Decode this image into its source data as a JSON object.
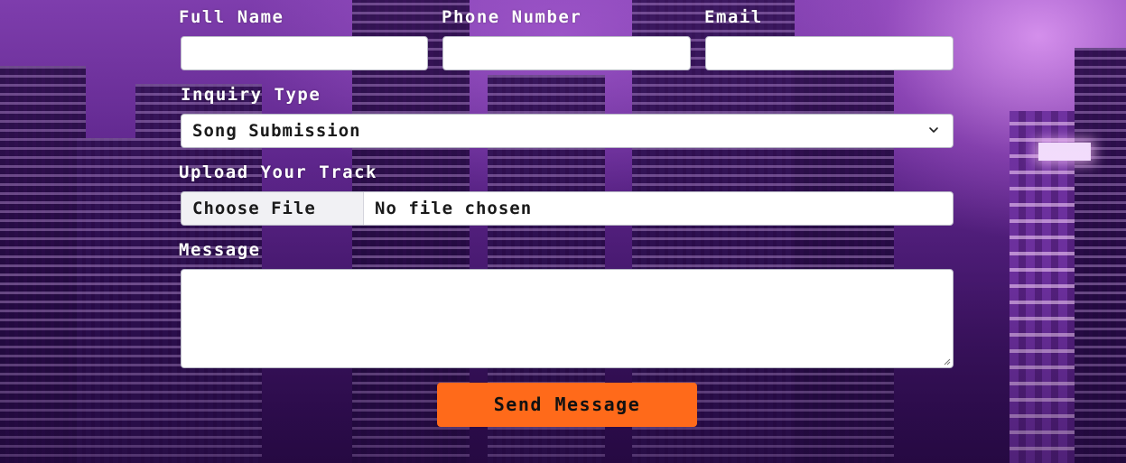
{
  "form": {
    "full_name_label": "Full Name",
    "phone_label": "Phone Number",
    "email_label": "Email",
    "full_name_value": "",
    "phone_value": "",
    "email_value": "",
    "inquiry_label": "Inquiry Type",
    "inquiry_selected": "Song Submission",
    "upload_label": "Upload Your Track",
    "file_button_label": "Choose File",
    "file_status": "No file chosen",
    "message_label": "Message",
    "message_value": "",
    "submit_label": "Send Message"
  },
  "icons": {
    "select": "chevron-down-icon",
    "textarea": "resize-handle-icon"
  },
  "colors": {
    "submit_button": "#ff6a1a",
    "label_text": "#ffffff",
    "field_background": "#ffffff"
  }
}
